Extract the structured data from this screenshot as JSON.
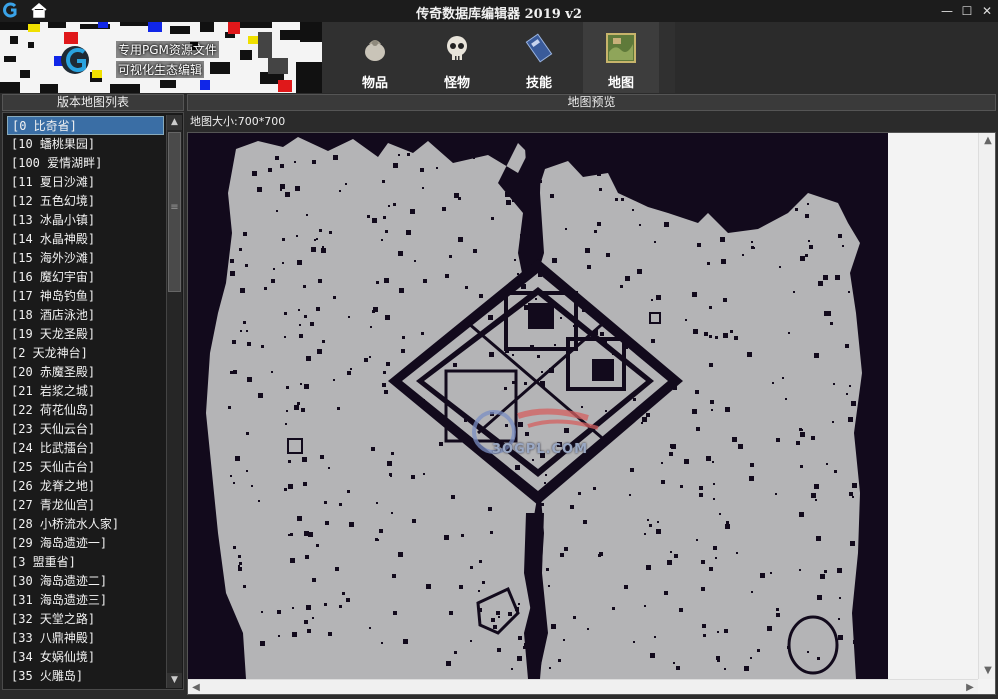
{
  "window": {
    "title": "传奇数据库编辑器 2019 v2"
  },
  "banner": {
    "line1": "专用PGM资源文件",
    "line2": "可视化生态编辑"
  },
  "toolbar": {
    "items": [
      {
        "label": "物品",
        "icon": "bag-icon"
      },
      {
        "label": "怪物",
        "icon": "skull-icon"
      },
      {
        "label": "技能",
        "icon": "skill-book-icon"
      },
      {
        "label": "地图",
        "icon": "map-icon"
      }
    ]
  },
  "left_panel": {
    "header": "版本地图列表",
    "selected_index": 0,
    "items": [
      "[0 比奇省]",
      "[10    蟠桃果园]",
      "[100   爱情湖畔]",
      "[11    夏日沙滩]",
      "[12    五色幻境]",
      "[13    冰晶小镇]",
      "[14    水晶神殿]",
      "[15    海外沙滩]",
      "[16    魔幻宇宙]",
      "[17    神岛钓鱼]",
      "[18    酒店泳池]",
      "[19    天龙圣殿]",
      "[2 天龙神台]",
      "[20    赤魔圣殿]",
      "[21    岩浆之城]",
      "[22    荷花仙岛]",
      "[23    天仙云台]",
      "[24    比武擂台]",
      "[25    天仙古台]",
      "[26    龙脊之地]",
      "[27    青龙仙宫]",
      "[28    小桥流水人家]",
      "[29    海岛遗迹一]",
      "[3 盟重省]",
      "[30    海岛遗迹二]",
      "[31    海岛遗迹三]",
      "[32    天堂之路]",
      "[33    八鼎神殿]",
      "[34    女娲仙境]",
      "[35    火雕岛]"
    ]
  },
  "right_panel": {
    "header": "地图预览",
    "map_size": "地图大小:700*700",
    "watermark": "3OGPL.COM"
  },
  "colors": {
    "terrain": "#b4b4b6",
    "void": "#120a1c",
    "selection": "#3a6ea5"
  }
}
